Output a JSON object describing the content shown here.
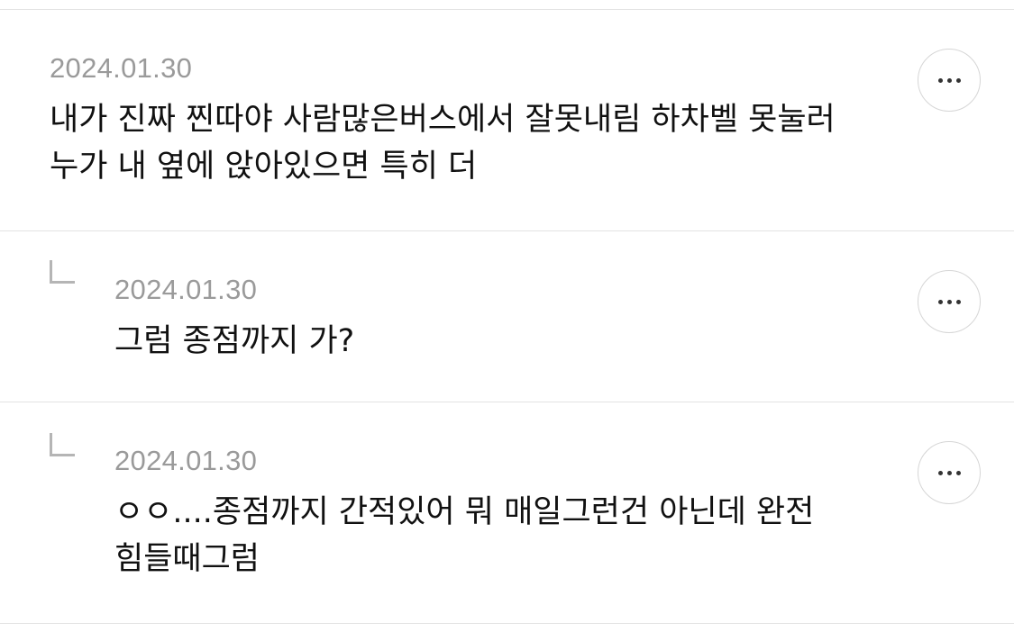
{
  "comments": [
    {
      "date": "2024.01.30",
      "text": "내가 진짜 찐따야 사람많은버스에서 잘못내림 하차벨 못눌러 누가 내 옆에 앉아있으면 특히 더",
      "is_reply": false,
      "more_icon": "more-horizontal-icon"
    },
    {
      "date": "2024.01.30",
      "text": "그럼 종점까지 가?",
      "is_reply": true,
      "more_icon": "more-horizontal-icon"
    },
    {
      "date": "2024.01.30",
      "text": "ㅇㅇ....종점까지 간적있어 뭐 매일그런건 아닌데 완전 힘들때그럼",
      "is_reply": true,
      "more_icon": "more-horizontal-icon"
    }
  ],
  "colors": {
    "divider": "#e3e3e3",
    "date_text": "#9a9a9a",
    "body_text": "#111111",
    "reply_mark": "#b5b5b5",
    "button_border": "#d6d6d6"
  }
}
